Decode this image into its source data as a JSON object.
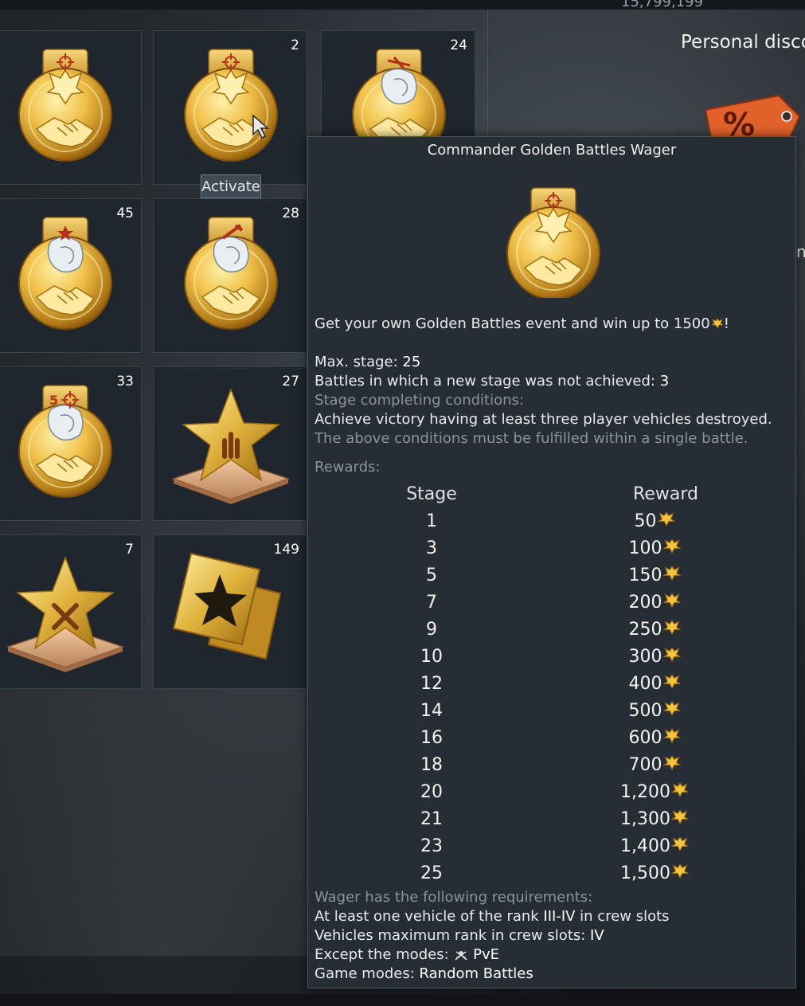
{
  "header": {
    "currency_fragment": "15,799,199",
    "right_title": "Personal disco"
  },
  "grid": {
    "activate_label": "Activate",
    "items": [
      {
        "count": "",
        "emblem": "eagle",
        "tab": "crosshair"
      },
      {
        "count": "2",
        "emblem": "eagle",
        "tab": "crosshair"
      },
      {
        "count": "24",
        "emblem": "lion",
        "tab": "plane"
      },
      {
        "count": "45",
        "emblem": "lion",
        "tab": "star"
      },
      {
        "count": "28",
        "emblem": "lion",
        "tab": "wrench"
      },
      {
        "count": "33",
        "emblem": "lion",
        "tab": "5-crosshair"
      },
      {
        "count": "27",
        "emblem": "star-award",
        "tab": ""
      },
      {
        "count": "7",
        "emblem": "star-award-cross",
        "tab": ""
      },
      {
        "count": "149",
        "emblem": "card",
        "tab": ""
      }
    ]
  },
  "tooltip": {
    "title": "Commander Golden Battles Wager",
    "description": "Get your own Golden Battles event and win up to 1500",
    "description_end": "!",
    "max_stage_label": "Max. stage: ",
    "max_stage_value": "25",
    "battles_label": "Battles in which a new stage was not achieved: ",
    "battles_value": "3",
    "conditions_label": "Stage completing conditions:",
    "conditions_text": "Achieve victory having at least three player vehicles destroyed.",
    "conditions_note": "The above conditions must be fulfilled within a single battle.",
    "rewards_label": "Rewards:",
    "col_stage": "Stage",
    "col_reward": "Reward",
    "rows": [
      {
        "stage": "1",
        "reward": "50"
      },
      {
        "stage": "3",
        "reward": "100"
      },
      {
        "stage": "5",
        "reward": "150"
      },
      {
        "stage": "7",
        "reward": "200"
      },
      {
        "stage": "9",
        "reward": "250"
      },
      {
        "stage": "10",
        "reward": "300"
      },
      {
        "stage": "12",
        "reward": "400"
      },
      {
        "stage": "14",
        "reward": "500"
      },
      {
        "stage": "16",
        "reward": "600"
      },
      {
        "stage": "18",
        "reward": "700"
      },
      {
        "stage": "20",
        "reward": "1,200"
      },
      {
        "stage": "21",
        "reward": "1,300"
      },
      {
        "stage": "23",
        "reward": "1,400"
      },
      {
        "stage": "25",
        "reward": "1,500"
      }
    ],
    "requirements_label": "Wager has the following requirements:",
    "req1_label": "At least one vehicle of the rank ",
    "req1_value": "III-IV",
    "req1_end": " in crew slots",
    "req2_label": "Vehicles maximum rank in crew slots: ",
    "req2_value": "IV",
    "req3_label": "Except the modes: ",
    "req3_value": "PvE",
    "req4_label": "Game modes: ",
    "req4_value": "Random Battles"
  },
  "colors": {
    "gold": "#e8b840",
    "panel": "#262d34",
    "cell": "#1f262d"
  }
}
